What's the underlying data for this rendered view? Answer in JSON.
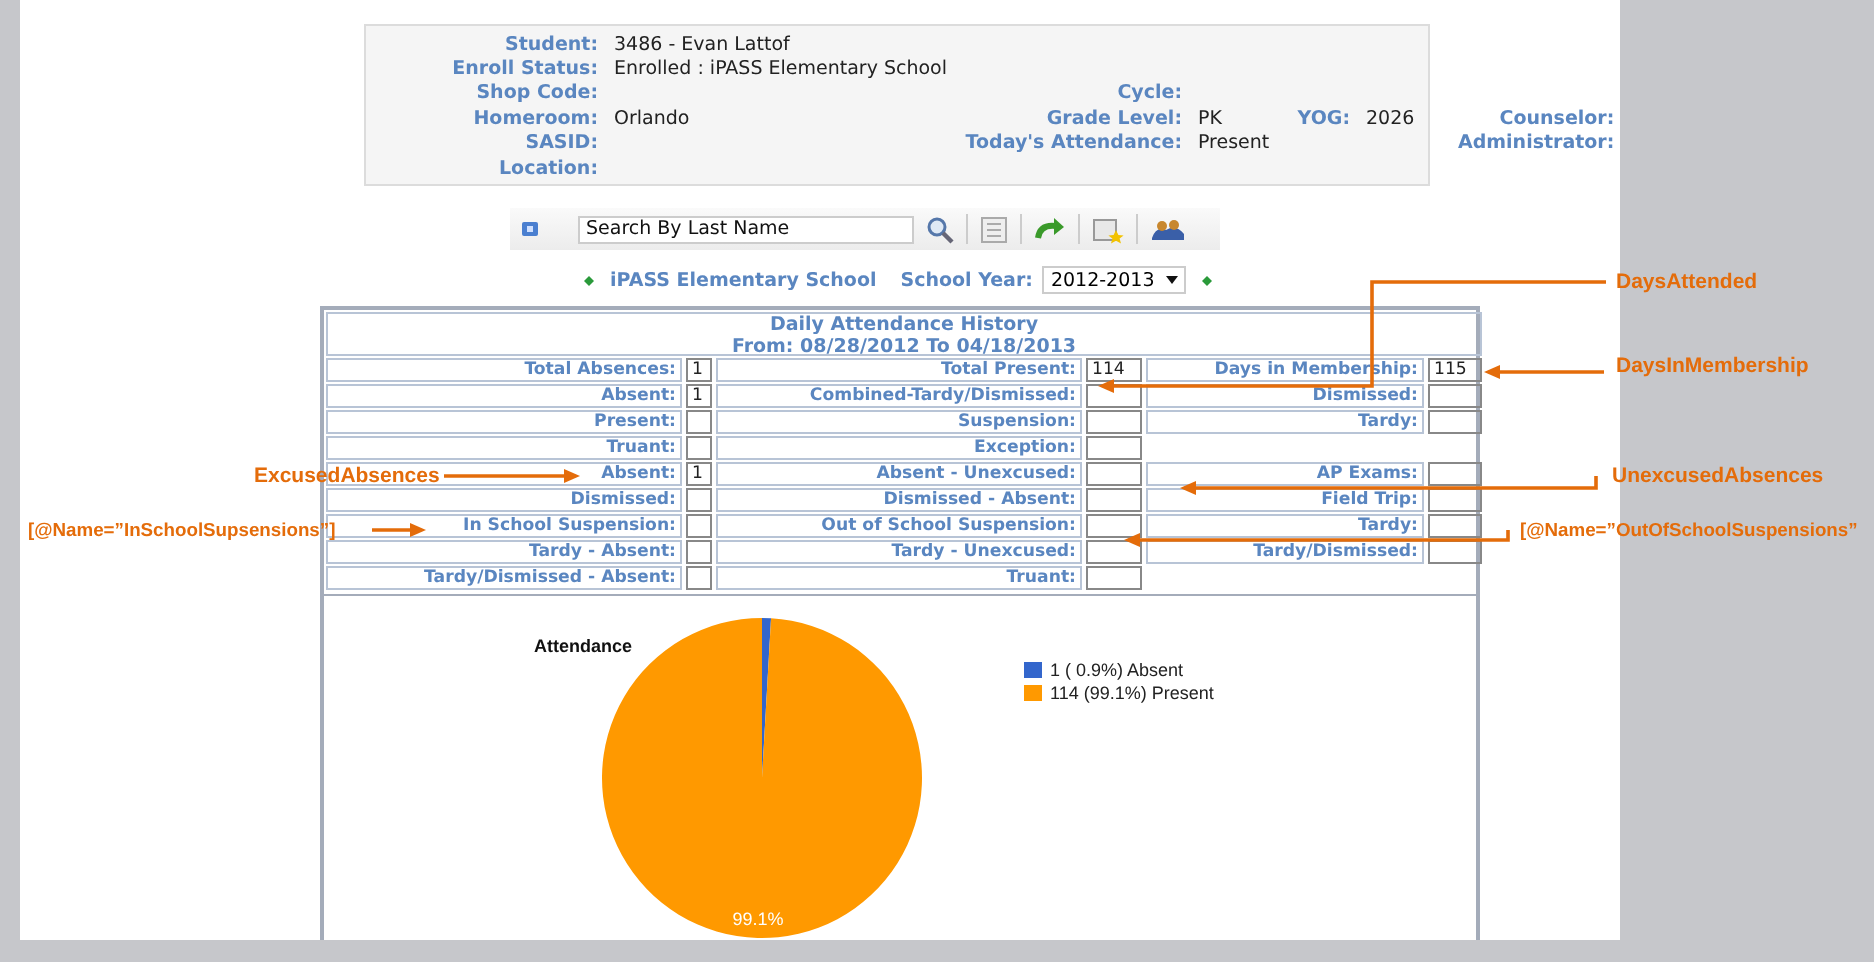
{
  "student_info": {
    "rows": [
      [
        {
          "label": "Student:",
          "value": "3486 - Evan Lattof"
        }
      ],
      [
        {
          "label": "Enroll Status:",
          "value": "Enrolled : iPASS Elementary School"
        }
      ],
      [
        {
          "label": "Shop Code:"
        },
        {
          "label": "Cycle:"
        }
      ],
      [
        {
          "label": "Homeroom:",
          "value": "Orlando"
        },
        {
          "label": "Grade Level:",
          "value": "PK"
        },
        {
          "label": "YOG:",
          "value": "2026"
        },
        {
          "label": "Counselor:"
        }
      ],
      [
        {
          "label": "SASID:"
        },
        {
          "label": "Today's Attendance:",
          "value": "Present"
        },
        {},
        {
          "label": "Administrator:"
        }
      ],
      [
        {
          "label": "Location:"
        }
      ]
    ]
  },
  "toolbar": {
    "search": {
      "placeholder": "Search By Last Name"
    }
  },
  "school_bar": {
    "school": "iPASS Elementary School",
    "year_label": "School Year:",
    "year": "2012-2013"
  },
  "attendance": {
    "title": "Daily Attendance History",
    "range": "From: 08/28/2012 To 04/18/2013",
    "rows": [
      [
        {
          "label": "Total Absences:",
          "value": "1"
        },
        {
          "label": "Total Present:",
          "value": "114"
        },
        {
          "label": "Days in Membership:",
          "value": "115"
        }
      ],
      [
        {
          "label": "Absent:",
          "value": "1"
        },
        {
          "label": "Combined-Tardy/Dismissed:"
        },
        {
          "label": "Dismissed:"
        }
      ],
      [
        {
          "label": "Present:"
        },
        {
          "label": "Suspension:"
        },
        {
          "label": "Tardy:"
        }
      ],
      [
        {
          "label": "Truant:"
        },
        {
          "label": "Exception:"
        }
      ],
      [
        {
          "label": "Absent:",
          "value": "1"
        },
        {
          "label": "Absent - Unexcused:"
        },
        {
          "label": "AP Exams:"
        }
      ],
      [
        {
          "label": "Dismissed:"
        },
        {
          "label": "Dismissed - Absent:"
        },
        {
          "label": "Field Trip:"
        }
      ],
      [
        {
          "label": "In School Suspension:"
        },
        {
          "label": "Out of School Suspension:"
        },
        {
          "label": "Tardy:"
        }
      ],
      [
        {
          "label": "Tardy - Absent:"
        },
        {
          "label": "Tardy - Unexcused:"
        },
        {
          "label": "Tardy/Dismissed:"
        }
      ],
      [
        {
          "label": "Tardy/Dismissed - Absent:"
        },
        {
          "label": "Truant:"
        }
      ]
    ]
  },
  "chart": {
    "chart_data": {
      "type": "pie",
      "title": "Attendance",
      "categories": [
        "1 ( 0.9%) Absent",
        "114 (99.1%) Present"
      ],
      "values": [
        0.9,
        99.1
      ],
      "value_labels": [
        null,
        "99.1%"
      ],
      "legend": "right"
    },
    "slices": [
      {
        "color": "#3366cc"
      },
      {
        "color": "#ff9900"
      }
    ]
  },
  "callouts": [
    {
      "text": "DaysAttended"
    },
    {
      "text": "DaysInMembership"
    },
    {
      "text": "ExcusedAbsences"
    },
    {
      "text": "UnexcusedAbsences"
    },
    {
      "text": "[@Name=”InSchoolSupsensions”]"
    },
    {
      "text": "[@Name=”OutOfSchoolSuspensions”"
    }
  ]
}
